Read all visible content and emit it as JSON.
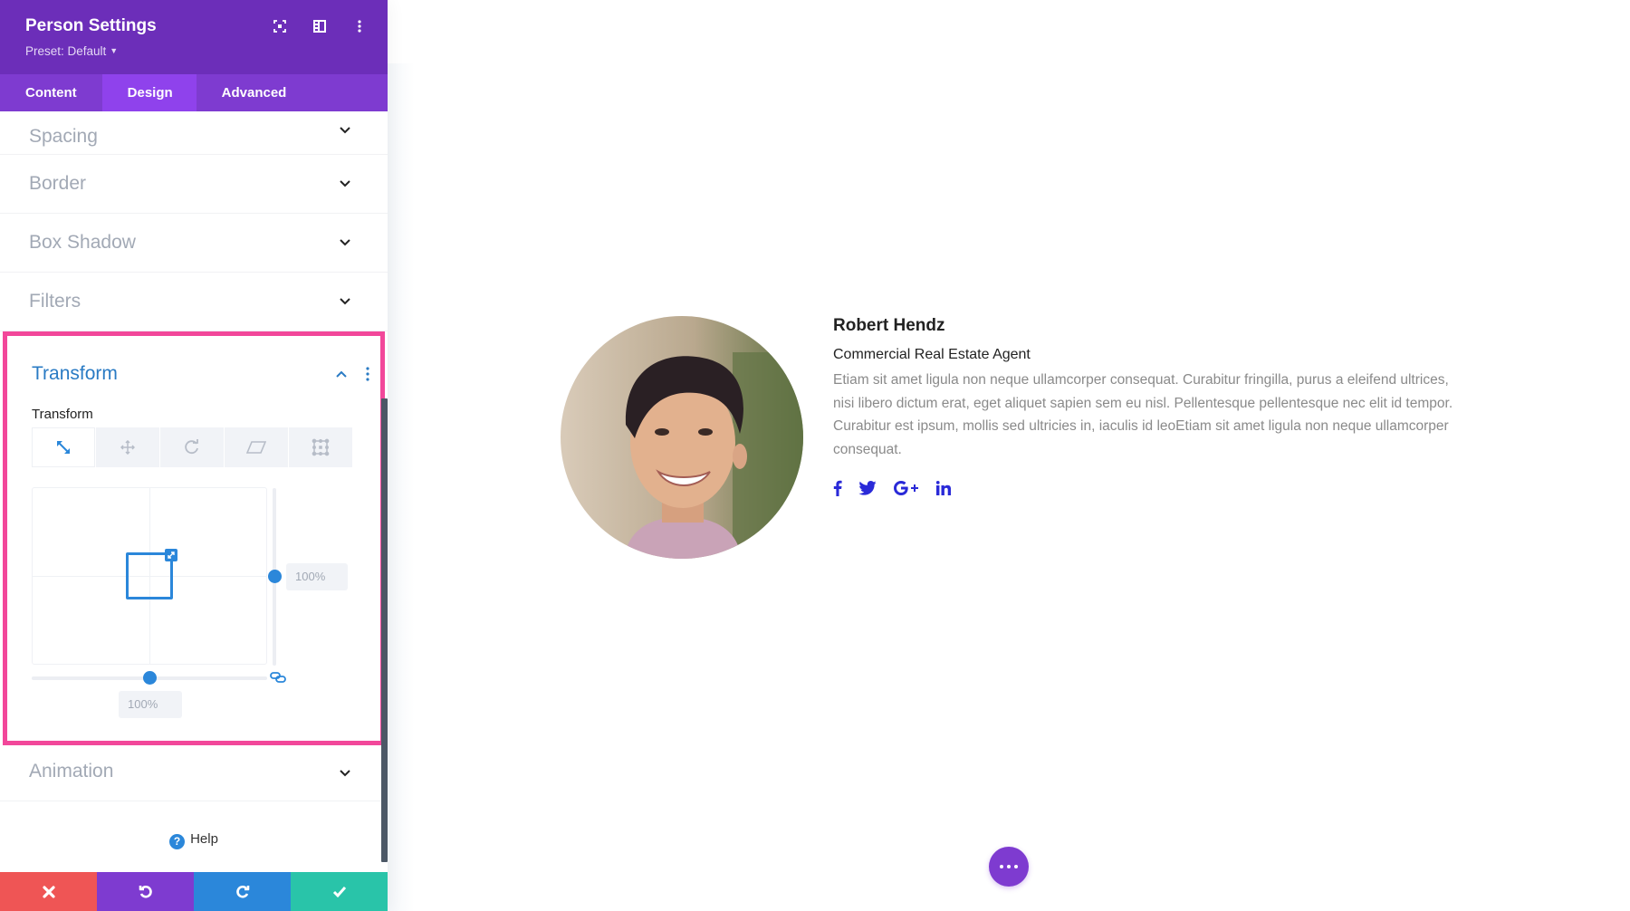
{
  "panel": {
    "title": "Person Settings",
    "preset": "Preset: Default",
    "header_icons": [
      "focus-mode-icon",
      "split-view-icon",
      "more-vertical-icon"
    ],
    "tabs": [
      {
        "label": "Content",
        "active": false
      },
      {
        "label": "Design",
        "active": true
      },
      {
        "label": "Advanced",
        "active": false
      }
    ],
    "sections": [
      {
        "label": "Spacing",
        "expanded": false
      },
      {
        "label": "Border",
        "expanded": false
      },
      {
        "label": "Box Shadow",
        "expanded": false
      },
      {
        "label": "Filters",
        "expanded": false
      }
    ],
    "transform": {
      "title": "Transform",
      "sublabel": "Transform",
      "tools": [
        "scale-icon",
        "translate-icon",
        "rotate-icon",
        "skew-icon",
        "origin-icon"
      ],
      "active_tool": "scale",
      "scale_y": "100%",
      "scale_x": "100%",
      "scale_y_value": 100,
      "scale_x_value": 100,
      "linked": true
    },
    "animation_label": "Animation",
    "help_label": "Help",
    "bottom_bar": [
      "cancel",
      "undo",
      "redo",
      "save"
    ],
    "colors": {
      "header": "#6c2eb9",
      "tabs": "#7e3bd0",
      "tab_active": "#8f42ec",
      "accent_blue": "#2b87da",
      "highlight_pink": "#f2479a",
      "cancel": "#ef5555",
      "undo": "#7e3bd0",
      "redo": "#2b87da",
      "save": "#29c4a9"
    }
  },
  "person": {
    "name": "Robert Hendz",
    "position": "Commercial Real Estate Agent",
    "bio": "Etiam sit amet ligula non neque ullamcorper consequat. Curabitur fringilla, purus a eleifend ultrices, nisi libero dictum erat, eget aliquet sapien sem eu nisl. Pellentesque pellentesque nec elit id tempor. Curabitur est ipsum, mollis sed ultricies in, iaculis id leoEtiam sit amet ligula non neque ullamcorper consequat.",
    "socials": [
      {
        "name": "facebook",
        "glyph": "f"
      },
      {
        "name": "twitter",
        "glyph": ""
      },
      {
        "name": "google-plus",
        "glyph": "G+"
      },
      {
        "name": "linkedin",
        "glyph": "in"
      }
    ],
    "social_color": "#2a2ad8"
  },
  "fab": {
    "icon": "more-horizontal-icon",
    "color": "#7e3bd0"
  }
}
